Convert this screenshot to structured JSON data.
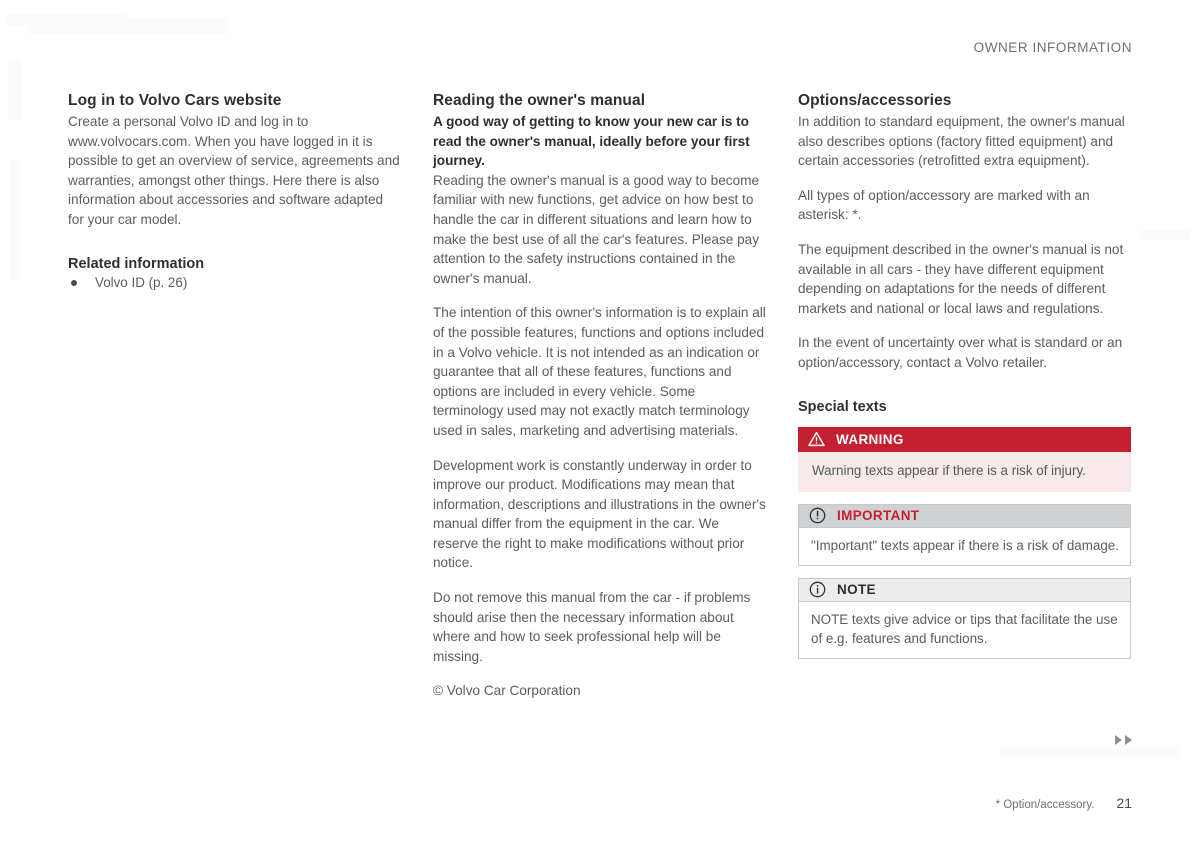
{
  "header": {
    "title": "OWNER INFORMATION"
  },
  "columns": {
    "left": {
      "heading": "Log in to Volvo Cars website",
      "paragraph": "Create a personal Volvo ID and log in to www.volvocars.com. When you have logged in it is possible to get an overview of service, agreements and warranties, amongst other things. Here there is also information about accessories and software adapted for your car model.",
      "related_heading": "Related information",
      "related_items": [
        "Volvo ID (p. 26)"
      ]
    },
    "middle": {
      "heading": "Reading the owner's manual",
      "lead": "A good way of getting to know your new car is to read the owner's manual, ideally before your first journey.",
      "paragraphs": [
        "Reading the owner's manual is a good way to become familiar with new functions, get advice on how best to handle the car in different situations and learn how to make the best use of all the car's features. Please pay attention to the safety instructions contained in the owner's manual.",
        "The intention of this owner's information is to explain all of the possible features, functions and options included in a Volvo vehicle. It is not intended as an indication or guarantee that all of these features, functions and options are included in every vehicle. Some terminology used may not exactly match terminology used in sales, marketing and advertising materials.",
        "Development work is constantly underway in order to improve our product. Modifications may mean that information, descriptions and illustrations in the owner's manual differ from the equipment in the car. We reserve the right to make modifications without prior notice.",
        "Do not remove this manual from the car - if problems should arise then the necessary information about where and how to seek professional help will be missing."
      ],
      "copyright": "© Volvo Car Corporation"
    },
    "right": {
      "heading": "Options/accessories",
      "paragraphs": [
        "In addition to standard equipment, the owner's manual also describes options (factory fitted equipment) and certain accessories (retrofitted extra equipment).",
        "All types of option/accessory are marked with an asterisk: *.",
        "The equipment described in the owner's manual is not available in all cars - they have different equipment depending on adaptations for the needs of different markets and national or local laws and regulations.",
        "In the event of uncertainty over what is standard or an option/accessory, contact a Volvo retailer."
      ],
      "special_heading": "Special texts",
      "boxes": [
        {
          "id": "warning",
          "icon": "warning-triangle-icon",
          "label": "WARNING",
          "text": "Warning texts appear if there is a risk of injury."
        },
        {
          "id": "important",
          "icon": "exclamation-circle-icon",
          "label": "IMPORTANT",
          "text": "\"Important\" texts appear if there is a risk of damage."
        },
        {
          "id": "note",
          "icon": "info-circle-icon",
          "label": "NOTE",
          "text": "NOTE texts give advice or tips that facilitate the use of e.g. features and functions."
        }
      ]
    }
  },
  "footer": {
    "option_note": "* Option/accessory.",
    "page_number": "21",
    "next_arrows_icon": "double-right-arrow-icon"
  },
  "colors": {
    "warning_red": "#c4202f",
    "warning_body": "#f8e9ea",
    "important_header": "#cfd1d2",
    "note_header": "#eceded",
    "body_text": "#5a5d61",
    "heading_text": "#2d3033"
  }
}
